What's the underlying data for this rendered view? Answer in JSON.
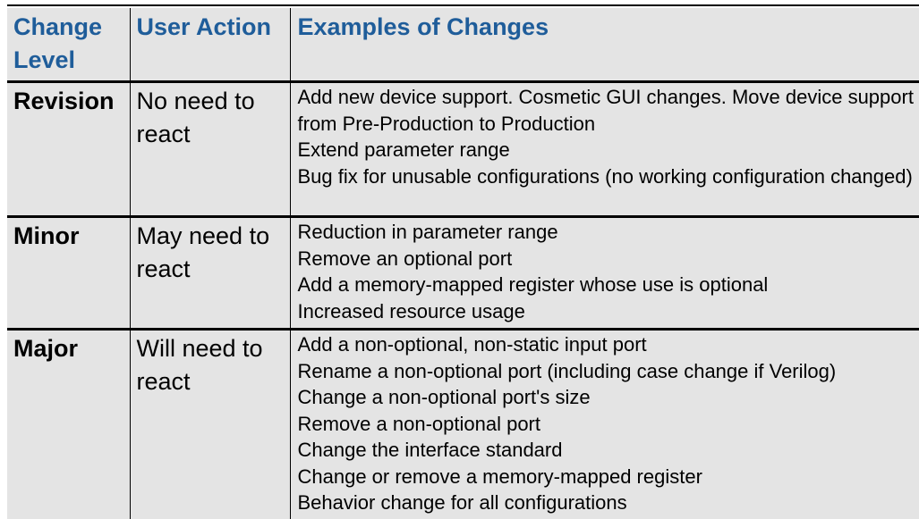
{
  "table": {
    "headers": {
      "change_level": "Change Level",
      "user_action": "User Action",
      "examples": "Examples of Changes"
    },
    "rows": [
      {
        "level": "Revision",
        "action": "No need to react",
        "examples": [
          "Add new device support. Cosmetic GUI changes. Move device support from Pre-Production to Production",
          "Extend parameter range",
          "Bug fix for unusable configurations (no working configuration changed)"
        ]
      },
      {
        "level": "Minor",
        "action": "May need to react",
        "examples": [
          "Reduction in parameter range",
          "Remove an optional port",
          "Add a memory-mapped register whose use is optional",
          "Increased resource usage"
        ]
      },
      {
        "level": "Major",
        "action": "Will need to react",
        "examples": [
          "Add a non-optional, non-static input port",
          "Rename a non-optional port (including case change if Verilog)",
          "Change a non-optional port's size",
          "Remove a non-optional port",
          "Change the interface standard",
          "Change or remove a memory-mapped register",
          "Behavior change for all configurations"
        ]
      }
    ]
  },
  "colors": {
    "header_text": "#1f5d9a",
    "cell_background": "#e4e4e4",
    "border": "#000000"
  }
}
